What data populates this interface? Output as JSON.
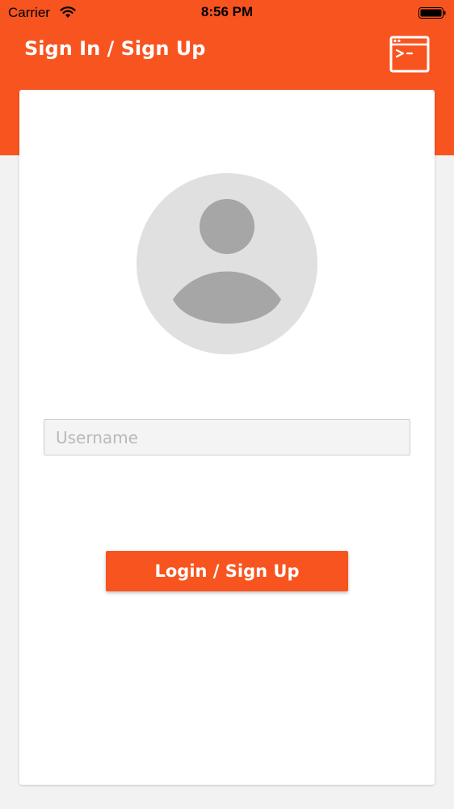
{
  "status_bar": {
    "carrier": "Carrier",
    "time": "8:56 PM",
    "wifi_icon": "wifi-icon",
    "battery_icon": "battery-icon"
  },
  "nav": {
    "title": "Sign In / Sign Up",
    "console_icon": "terminal-icon"
  },
  "form": {
    "avatar_icon": "user-avatar-icon",
    "username_placeholder": "Username",
    "username_value": "",
    "submit_label": "Login / Sign Up"
  },
  "colors": {
    "accent": "#f75420",
    "background": "#f2f2f2",
    "card": "#ffffff",
    "avatar_bg": "#e0e0e0",
    "avatar_fg": "#a6a6a6"
  }
}
